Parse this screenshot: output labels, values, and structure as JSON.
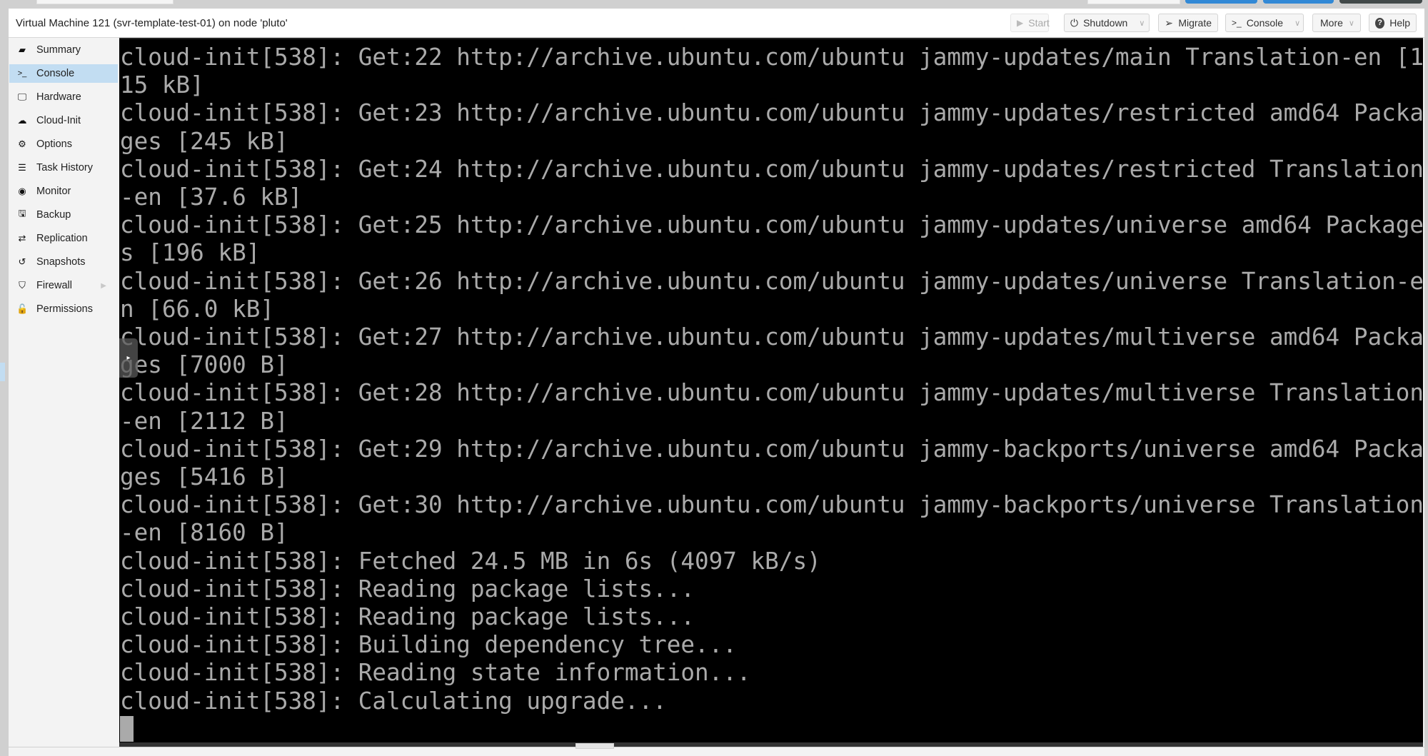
{
  "header": {
    "title": "Virtual Machine 121 (svr-template-test-01) on node 'pluto'"
  },
  "toolbar": {
    "start": {
      "label": "Start",
      "icon": "play-icon",
      "glyph": "▶",
      "disabled": true
    },
    "shutdown": {
      "label": "Shutdown",
      "icon": "power-icon",
      "glyph": "⏻"
    },
    "migrate": {
      "label": "Migrate",
      "icon": "paper-plane-icon",
      "glyph": "➢"
    },
    "console": {
      "label": "Console",
      "icon": "terminal-icon",
      "glyph": ">_"
    },
    "more": {
      "label": "More"
    },
    "help": {
      "label": "Help",
      "icon": "question-circle-icon",
      "glyph": "?"
    },
    "chevron_glyph": "∨"
  },
  "sidebar": {
    "active": "Console",
    "items": [
      {
        "label": "Summary",
        "icon": "book-icon",
        "glyph": "▰"
      },
      {
        "label": "Console",
        "icon": "terminal-icon",
        "glyph": ">_"
      },
      {
        "label": "Hardware",
        "icon": "desktop-icon",
        "glyph": "🖵"
      },
      {
        "label": "Cloud-Init",
        "icon": "cloud-icon",
        "glyph": "☁"
      },
      {
        "label": "Options",
        "icon": "gear-icon",
        "glyph": "⚙"
      },
      {
        "label": "Task History",
        "icon": "list-alt-icon",
        "glyph": "☰"
      },
      {
        "label": "Monitor",
        "icon": "eye-icon",
        "glyph": "◉"
      },
      {
        "label": "Backup",
        "icon": "floppy-icon",
        "glyph": "🖫"
      },
      {
        "label": "Replication",
        "icon": "retweet-icon",
        "glyph": "⇄"
      },
      {
        "label": "Snapshots",
        "icon": "history-icon",
        "glyph": "↺"
      },
      {
        "label": "Firewall",
        "icon": "shield-icon",
        "glyph": "⛉",
        "has_submenu": true,
        "submenu_glyph": "▶"
      },
      {
        "label": "Permissions",
        "icon": "unlock-icon",
        "glyph": "🔓"
      }
    ]
  },
  "console": {
    "collapse_handle_glyph": "▸",
    "lines": [
      "cloud-init[538]: Get:22 http://archive.ubuntu.com/ubuntu jammy-updates/main Translation-en [1",
      "15 kB]",
      "cloud-init[538]: Get:23 http://archive.ubuntu.com/ubuntu jammy-updates/restricted amd64 Packa",
      "ges [245 kB]",
      "cloud-init[538]: Get:24 http://archive.ubuntu.com/ubuntu jammy-updates/restricted Translation",
      "-en [37.6 kB]",
      "cloud-init[538]: Get:25 http://archive.ubuntu.com/ubuntu jammy-updates/universe amd64 Package",
      "s [196 kB]",
      "cloud-init[538]: Get:26 http://archive.ubuntu.com/ubuntu jammy-updates/universe Translation-e",
      "n [66.0 kB]",
      "cloud-init[538]: Get:27 http://archive.ubuntu.com/ubuntu jammy-updates/multiverse amd64 Packa",
      "ges [7000 B]",
      "cloud-init[538]: Get:28 http://archive.ubuntu.com/ubuntu jammy-updates/multiverse Translation",
      "-en [2112 B]",
      "cloud-init[538]: Get:29 http://archive.ubuntu.com/ubuntu jammy-backports/universe amd64 Packa",
      "ges [5416 B]",
      "cloud-init[538]: Get:30 http://archive.ubuntu.com/ubuntu jammy-backports/universe Translation",
      "-en [8160 B]",
      "cloud-init[538]: Fetched 24.5 MB in 6s (4097 kB/s)",
      "cloud-init[538]: Reading package lists...",
      "cloud-init[538]: Reading package lists...",
      "cloud-init[538]: Building dependency tree...",
      "cloud-init[538]: Reading state information...",
      "cloud-init[538]: Calculating upgrade..."
    ]
  },
  "colors": {
    "selected_nav": "#c2ddf2",
    "terminal_bg": "#000000",
    "terminal_fg": "#aaaaaa",
    "top_button_blue": "#3289d6",
    "top_button_dark": "#424a4a"
  }
}
